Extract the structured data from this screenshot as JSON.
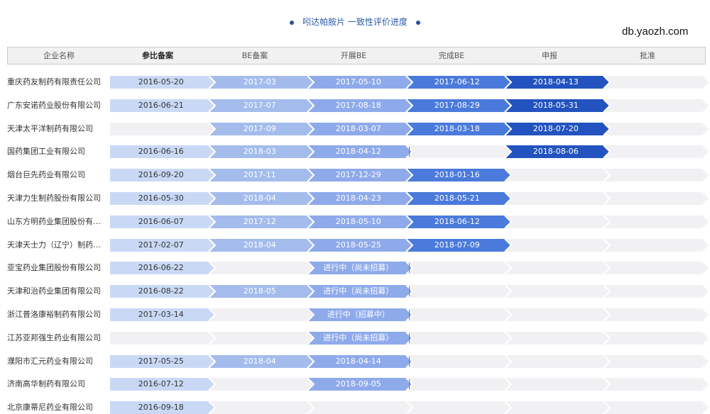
{
  "title": "吲达帕胺片 一致性评价进度",
  "site": "db.yaozh.com",
  "chart_data": {
    "type": "table",
    "columns": [
      "企业名称",
      "参比备案",
      "BE备案",
      "开展BE",
      "完成BE",
      "申报",
      "批准"
    ],
    "rows": [
      {
        "company": "重庆药友制药有限责任公司",
        "cells": [
          "2016-05-20",
          "2017-03",
          "2017-05-10",
          "2017-06-12",
          "2018-04-13",
          ""
        ]
      },
      {
        "company": "广东安诺药业股份有限公司",
        "cells": [
          "2016-06-21",
          "2017-07",
          "2017-08-18",
          "2017-08-29",
          "2018-05-31",
          ""
        ]
      },
      {
        "company": "天津太平洋制药有限公司",
        "cells": [
          "",
          "2017-09",
          "2018-03-07",
          "2018-03-18",
          "2018-07-20",
          ""
        ]
      },
      {
        "company": "国药集团工业有限公司",
        "cells": [
          "2016-06-16",
          "2018-03",
          "2018-04-12",
          "",
          "2018-08-06",
          ""
        ]
      },
      {
        "company": "烟台巨先药业有限公司",
        "cells": [
          "2016-09-20",
          "2017-11",
          "2017-12-29",
          "2018-01-16",
          "",
          ""
        ]
      },
      {
        "company": "天津力生制药股份有限公司",
        "cells": [
          "2016-05-30",
          "2018-04",
          "2018-04-23",
          "2018-05-21",
          "",
          ""
        ]
      },
      {
        "company": "山东方明药业集团股份有…",
        "cells": [
          "2016-06-07",
          "2017-12",
          "2018-05-10",
          "2018-06-12",
          "",
          ""
        ]
      },
      {
        "company": "天津天士力（辽宁）制药…",
        "cells": [
          "2017-02-07",
          "2018-04",
          "2018-05-25",
          "2018-07-09",
          "",
          ""
        ]
      },
      {
        "company": "亚宝药业集团股份有限公司",
        "cells": [
          "2016-06-22",
          "",
          "进行中（尚未招募）",
          "",
          "",
          ""
        ]
      },
      {
        "company": "天津和治药业集团有限公司",
        "cells": [
          "2016-08-22",
          "2018-05",
          "进行中（尚未招募）",
          "",
          "",
          ""
        ]
      },
      {
        "company": "浙江普洛康裕制药有限公司",
        "cells": [
          "2017-03-14",
          "",
          "进行中（招募中）",
          "",
          "",
          ""
        ]
      },
      {
        "company": "江苏亚邦强生药业有限公司",
        "cells": [
          "",
          "",
          "进行中（尚未招募）",
          "",
          "",
          ""
        ]
      },
      {
        "company": "濮阳市汇元药业有限公司",
        "cells": [
          "2017-05-25",
          "2018-04",
          "2018-04-14",
          "",
          "",
          ""
        ]
      },
      {
        "company": "济南高华制药有限公司",
        "cells": [
          "2016-07-12",
          "",
          "2018-09-05",
          "",
          "",
          ""
        ]
      },
      {
        "company": "北京康蒂尼药业有限公司",
        "cells": [
          "2016-09-18",
          "",
          "",
          "",
          "",
          ""
        ]
      }
    ],
    "colors": {
      "stage_fill": [
        "#c9d9f5",
        "#a3bcec",
        "#8eaaea",
        "#4a7adb",
        "#2253bf",
        "#f1f1f3"
      ],
      "stage_text": [
        "#333333",
        "#ffffff",
        "#ffffff",
        "#ffffff",
        "#ffffff",
        "#333333"
      ],
      "empty_fill": "#f1f1f3",
      "header_bg": "#f1f1f1"
    }
  }
}
